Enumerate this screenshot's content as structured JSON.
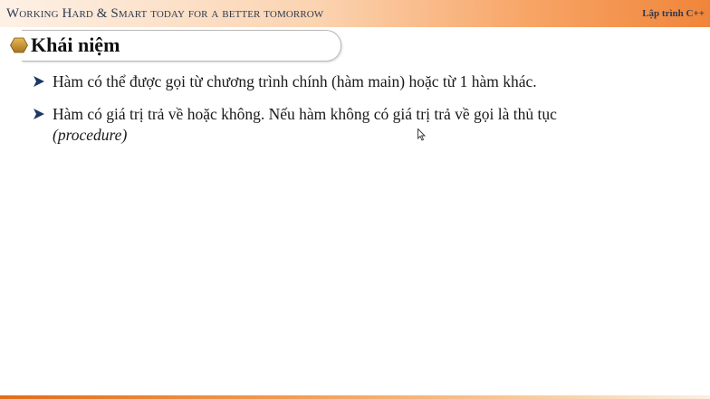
{
  "header": {
    "tagline": "Working Hard & Smart today for a better tomorrow",
    "course": "Lập trình C++"
  },
  "section": {
    "title": "Khái niệm",
    "icon": "hexagon-icon"
  },
  "bullets": [
    {
      "text": "Hàm có thể được gọi từ chương trình chính (hàm main) hoặc từ 1 hàm khác."
    },
    {
      "text": "Hàm có giá trị trả về hoặc không. Nếu hàm không có giá trị trả về gọi là thủ tục",
      "italic_text": "(procedure)"
    }
  ],
  "colors": {
    "accent_orange": "#f0853a",
    "header_text": "#2e3a4f",
    "bullet_arrow": "#1f3864",
    "hexagon": "#c8922e"
  }
}
